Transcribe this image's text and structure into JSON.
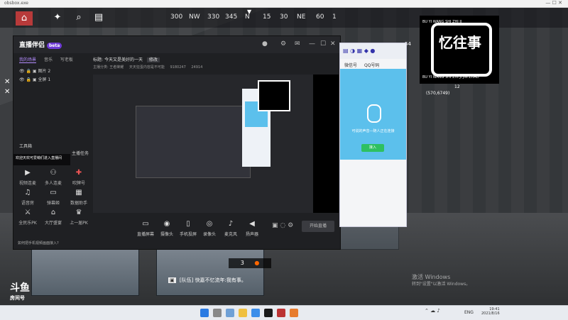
{
  "window_title": "obsbox.exe",
  "compass": {
    "ticks": [
      "300",
      "NW",
      "330",
      "345",
      "N",
      "15",
      "30",
      "NE",
      "60",
      "1"
    ]
  },
  "game_hud": {
    "coords": "(570,6749)",
    "player_count": "54",
    "level": "12"
  },
  "streamer_app": {
    "name": "直播伴侣",
    "badge": "beta",
    "tabs": [
      "我的场景",
      "音乐",
      "写老板"
    ],
    "scenes": [
      "图片 2",
      "全屏 1"
    ],
    "title_label": "标题:",
    "title_value": "今天又是美好的一天",
    "title_edit": "修改",
    "info_line": [
      "主播分类: 王者荣耀",
      "天天狂蛋内容是不可能",
      "9180247",
      "24914"
    ],
    "tools_header": "工具箱",
    "tools": [
      {
        "label": "视频连麦",
        "icon": "video-call-icon"
      },
      {
        "label": "多人连麦",
        "icon": "multi-call-icon"
      },
      {
        "label": "吹牌号",
        "icon": "gift-icon"
      },
      {
        "label": "语音房",
        "icon": "voice-room-icon"
      },
      {
        "label": "弹幕姬",
        "icon": "danmaku-icon"
      },
      {
        "label": "数据助手",
        "icon": "stats-icon"
      },
      {
        "label": "全民乐PK",
        "icon": "pk-icon"
      },
      {
        "label": "大厅盛宴",
        "icon": "hall-icon"
      },
      {
        "label": "上一届PK",
        "icon": "history-icon"
      }
    ],
    "tools_right": "主播任务",
    "chat_welcome": "欢迎天欢可爱萌们进入直播间",
    "footer_text": "如何把手机视频画面接入?",
    "bottom_tools": [
      {
        "label": "直播屏幕",
        "icon": "screen-icon"
      },
      {
        "label": "摄像头",
        "icon": "camera-icon"
      },
      {
        "label": "手机投屏",
        "icon": "phone-cast-icon"
      },
      {
        "label": "录像头",
        "icon": "record-icon"
      },
      {
        "label": "麦克风",
        "icon": "microphone-icon"
      },
      {
        "label": "扬声器",
        "icon": "speaker-icon"
      }
    ],
    "start_label": "开始直播"
  },
  "qq_window": {
    "tabs": [
      "微信号",
      "QQ号码"
    ],
    "message": "可说的声音—随人正在连接",
    "accept_label": "接入"
  },
  "logo_box": {
    "top_text": "BU YI WANG SHI   ZHI JI",
    "main_text": "忆往事",
    "bottom_text": "BU YI WANG SHI   ZHI JI JIN ZHAO"
  },
  "game_chat": {
    "team_tag": "[队伍]",
    "message": "快嘉不忆流年:我有事。"
  },
  "room_label": "房间号",
  "score": "3",
  "os_watermark": {
    "line1": "激活 Windows",
    "line2": "转到\"设置\"以激活 Windows。"
  },
  "taskbar": {
    "time": "19:41",
    "date": "2021/8/16",
    "lang": "ENG"
  }
}
